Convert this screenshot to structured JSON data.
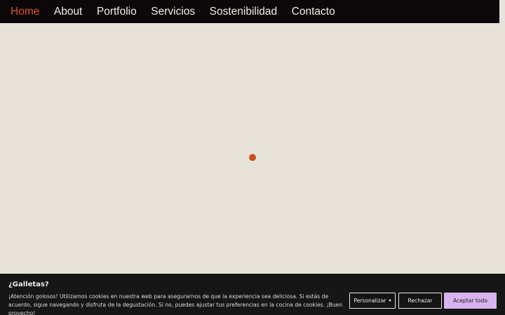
{
  "nav": {
    "items": [
      {
        "label": "Home",
        "active": true
      },
      {
        "label": "About",
        "active": false
      },
      {
        "label": "Portfolio",
        "active": false
      },
      {
        "label": "Servicios",
        "active": false
      },
      {
        "label": "Sostenibilidad",
        "active": false
      },
      {
        "label": "Contacto",
        "active": false
      }
    ]
  },
  "cookie": {
    "title": "¿Galletas?",
    "text": "¡Atención golosos! Utilizamos cookies en nuestra web para asegurarnos de que la experiencia sea deliciosa. Si estás de acuerdo, sigue navegando y disfruta de la degustación. Si no, puedes ajustar tus preferencias en la cocina de cookies. ¡Buen provecho!",
    "customize_label": "Personalizar",
    "reject_label": "Rechazar",
    "accept_label": "Aceptar todo"
  },
  "colors": {
    "nav_bg": "#0c0708",
    "nav_active": "#d9542b",
    "page_bg": "#e8e3d9",
    "loader": "#cc4e1c",
    "banner_bg": "#161616",
    "accept_bg": "#d8b4ee"
  },
  "icons": {
    "customize_caret": "caret-down-icon"
  }
}
